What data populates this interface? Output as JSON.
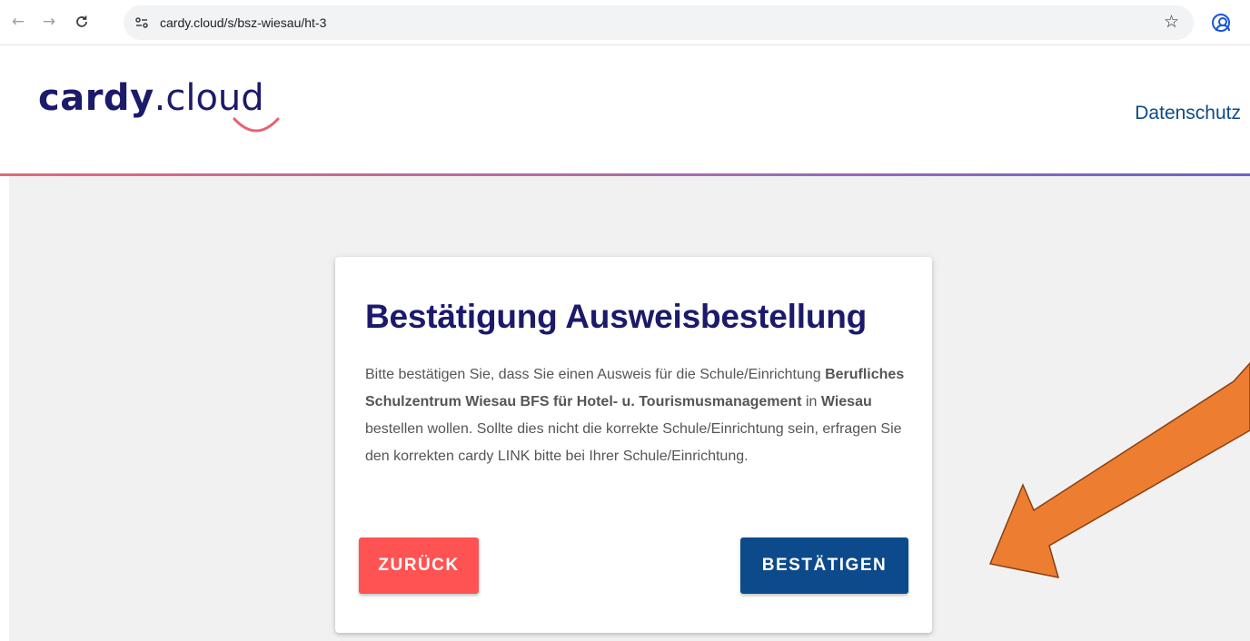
{
  "browser": {
    "url": "cardy.cloud/s/bsz-wiesau/ht-3",
    "icons": [
      "back-arrow-icon",
      "forward-arrow-icon",
      "reload-icon",
      "site-settings-icon",
      "star-icon",
      "profile-icon"
    ]
  },
  "header": {
    "logo_bold": "cardy",
    "logo_light": ".cloud",
    "nav_link": "Datenschutz"
  },
  "card": {
    "title": "Bestätigung Ausweisbestellung",
    "text_1": "Bitte bestätigen Sie, dass Sie einen Ausweis für die Schule/Einrichtung ",
    "school_name": "Berufliches Schulzentrum Wiesau BFS für Hotel- u. Tourismusmanagement",
    "text_2": " in ",
    "city": "Wiesau",
    "text_3": " bestellen wollen. Sollte dies nicht die korrekte Schule/Einrichtung sein, erfragen Sie den korrekten cardy LINK bitte bei Ihrer Schule/Einrichtung.",
    "back_label": "ZURÜCK",
    "confirm_label": "BESTÄTIGEN"
  },
  "colors": {
    "brand_navy": "#1c1a6b",
    "confirm_button": "#0c4a8c",
    "back_button": "#ff5252",
    "annotation_arrow": "#ed7d31"
  }
}
